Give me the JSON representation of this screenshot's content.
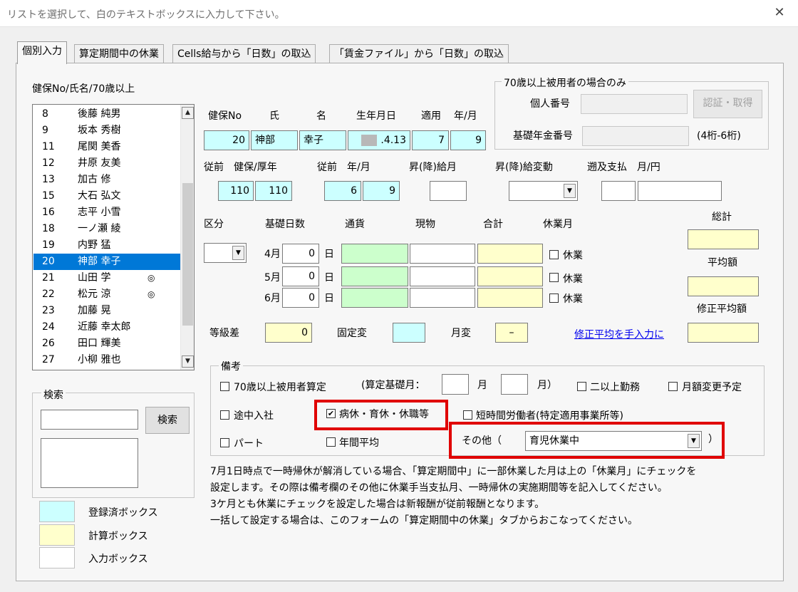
{
  "window": {
    "title": "リストを選択して、白のテキストボックスに入力して下さい。",
    "close": "✕"
  },
  "tabs": [
    "個別入力",
    "算定期間中の休業",
    "Cells給与から「日数」の取込",
    "「賃金ファイル」から「日数」の取込"
  ],
  "list": {
    "header": "健保No/氏名/70歳以上",
    "items": [
      {
        "no": "8",
        "name": "後藤 純男",
        "mark": ""
      },
      {
        "no": "9",
        "name": "坂本 秀樹",
        "mark": ""
      },
      {
        "no": "11",
        "name": "尾関 美香",
        "mark": ""
      },
      {
        "no": "12",
        "name": "井原 友美",
        "mark": ""
      },
      {
        "no": "13",
        "name": "加古 修",
        "mark": ""
      },
      {
        "no": "15",
        "name": "大石 弘文",
        "mark": ""
      },
      {
        "no": "16",
        "name": "志平 小雪",
        "mark": ""
      },
      {
        "no": "18",
        "name": "一ノ瀬 綾",
        "mark": ""
      },
      {
        "no": "19",
        "name": "内野 猛",
        "mark": ""
      },
      {
        "no": "20",
        "name": "神部 幸子",
        "mark": ""
      },
      {
        "no": "21",
        "name": "山田 学",
        "mark": "◎"
      },
      {
        "no": "22",
        "name": "松元 涼",
        "mark": "◎"
      },
      {
        "no": "23",
        "name": "加藤 晃",
        "mark": ""
      },
      {
        "no": "24",
        "name": "近藤 幸太郎",
        "mark": ""
      },
      {
        "no": "26",
        "name": "田口 輝美",
        "mark": ""
      },
      {
        "no": "27",
        "name": "小柳 雅也",
        "mark": ""
      }
    ],
    "selected_index": 9
  },
  "search": {
    "group_label": "検索",
    "button": "検索",
    "value": ""
  },
  "legend": [
    {
      "label": "登録済ボックス",
      "color": "#ccffff"
    },
    {
      "label": "計算ボックス",
      "color": "#ffffcc"
    },
    {
      "label": "入力ボックス",
      "color": "#ffffff"
    }
  ],
  "person": {
    "headers": {
      "no": "健保No",
      "last": "氏",
      "first": "名",
      "birth": "生年月日",
      "apply": "適用",
      "ym": "年/月"
    },
    "no": "20",
    "last": "神部",
    "first": "幸子",
    "birth": ".4.13",
    "apply": "7",
    "month": "9"
  },
  "prev": {
    "h_std": "従前　健保/厚年",
    "h_ym": "従前　年/月",
    "h_raise": "昇(降)給月",
    "h_change": "昇(降)給変動",
    "h_retro": "遡及支払　月/円",
    "health": "110",
    "pension": "110",
    "year": "6",
    "month": "9",
    "raise": "",
    "change": "",
    "retro_month": "",
    "retro_amount": ""
  },
  "over70": {
    "group_label": "70歳以上被用者の場合のみ",
    "personal_no_label": "個人番号",
    "pension_no_label": "基礎年金番号",
    "button": "認証・取得",
    "digits_note": "(4桁-6桁)"
  },
  "wages": {
    "h_class": "区分",
    "h_days": "基礎日数",
    "h_currency": "通貨",
    "h_goods": "現物",
    "h_total": "合計",
    "h_leave": "休業月",
    "day_unit": "日",
    "leave_label": "休業",
    "rows": [
      {
        "month": "4月",
        "days": "0"
      },
      {
        "month": "5月",
        "days": "0"
      },
      {
        "month": "6月",
        "days": "0"
      }
    ],
    "grand_total_label": "総計",
    "average_label": "平均額",
    "adjusted_label": "修正平均額"
  },
  "grade": {
    "diff_label": "等級差",
    "diff_value": "0",
    "fixed_label": "固定変",
    "monthly_label": "月変",
    "monthly_value": "–",
    "manual_link": "修正平均を手入力に"
  },
  "remarks": {
    "group_label": "備考",
    "over70_calc": "70歳以上被用者算定",
    "base_month_label": "(算定基礎月：",
    "month_unit": "月",
    "close_paren": "月）",
    "multi_work": "二以上勤務",
    "planned_change": "月額変更予定",
    "mid_join": "途中入社",
    "sick_leave": "病休・育休・休職等",
    "short_time": "短時間労働者(特定適用事業所等)",
    "part": "パート",
    "annual_avg": "年間平均",
    "other_label": "その他（",
    "other_value": "育児休業中",
    "other_close": "）",
    "sick_leave_checked": "✔"
  },
  "notes": [
    "7月1日時点で一時帰休が解消している場合、「算定期間中」に一部休業した月は上の「休業月」にチェックを",
    "設定します。その際は備考欄のその他に休業手当支払月、一時帰休の実施期間等を記入してください。",
    "3ケ月とも休業にチェックを設定した場合は新報酬が従前報酬となります。",
    "一括して設定する場合は、このフォームの「算定期間中の休業」タブからおこなってください。"
  ],
  "glyphs": {
    "arrow_up": "▲",
    "arrow_down": "▼"
  }
}
